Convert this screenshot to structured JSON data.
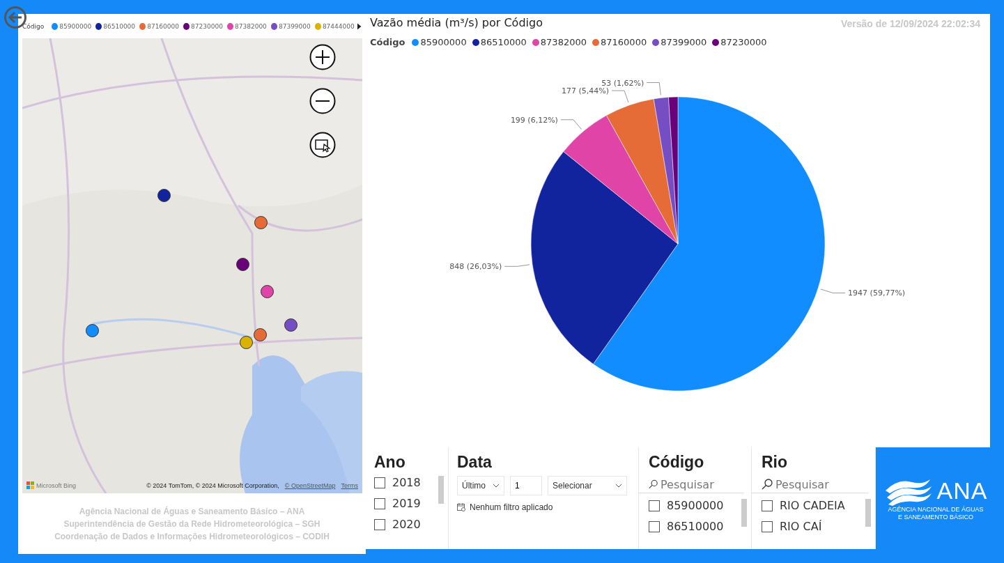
{
  "map_panel": {
    "legend": {
      "title": "Código",
      "items": [
        {
          "label": "85900000",
          "color": "#118dff"
        },
        {
          "label": "86510000",
          "color": "#12239e"
        },
        {
          "label": "87160000",
          "color": "#e66c37"
        },
        {
          "label": "87230000",
          "color": "#6b007b"
        },
        {
          "label": "87382000",
          "color": "#e044a7"
        },
        {
          "label": "87399000",
          "color": "#744ec2"
        },
        {
          "label": "87444000",
          "color": "#d9b300"
        }
      ]
    },
    "map": {
      "kind": "picture",
      "markers": [
        {
          "color": "#118dff"
        },
        {
          "color": "#12239e"
        },
        {
          "color": "#e66c37"
        },
        {
          "color": "#6b007b"
        },
        {
          "color": "#e044a7"
        },
        {
          "color": "#744ec2"
        },
        {
          "color": "#d9b300"
        },
        {
          "color": "#e66c37"
        }
      ],
      "provider": "Microsoft Bing",
      "attribution": "© 2024 TomTom, © 2024 Microsoft Corporation,",
      "attribution_link": "© OpenStreetMap",
      "terms_link": "Terms"
    },
    "footer": [
      "Agência Nacional de Águas e Saneamento Básico – ANA",
      "Superintendência de Gestão da Rede Hidrometeorológica – SGH",
      "Coordenação de Dados e Informações Hidrometeorológicos – CODIH"
    ]
  },
  "chart_panel": {
    "title": "Vazão média (m³/s) por Código",
    "version": "Versão de 12/09/2024 22:02:34",
    "legend": {
      "title": "Código",
      "items": [
        {
          "color": "#118dff"
        },
        {
          "color": "#12239e"
        },
        {
          "color": "#e044a7"
        },
        {
          "color": "#e66c37"
        },
        {
          "color": "#744ec2"
        },
        {
          "color": "#6b007b"
        }
      ]
    },
    "chart_data": {
      "type": "pie",
      "categories": [
        "85900000",
        "86510000",
        "87382000",
        "87160000",
        "87399000",
        "87230000"
      ],
      "series": [
        {
          "values": [
            59.77,
            26.03,
            6.12,
            5.44,
            1.62,
            1.02
          ]
        }
      ],
      "value_labels": [
        "1947 (59,77%)",
        "848 (26,03%)",
        "199 (6,12%)",
        "177 (5,44%)",
        "53 (1,62%)",
        null
      ]
    }
  },
  "slicers": {
    "ano": {
      "title": "Ano",
      "items": [
        {
          "label": "2018",
          "checked": false
        },
        {
          "label": "2019",
          "checked": false
        },
        {
          "label": "2020",
          "checked": false
        }
      ]
    },
    "data": {
      "title": "Data",
      "mode": "Último",
      "count": "1",
      "unit": "Selecionar",
      "status": "Nenhum filtro aplicado"
    },
    "codigo": {
      "title": "Código",
      "placeholder": "Pesquisar",
      "items": [
        {
          "label": "85900000",
          "checked": false
        },
        {
          "label": "86510000",
          "checked": false
        }
      ]
    },
    "rio": {
      "title": "Rio",
      "placeholder": "Pesquisar",
      "items": [
        {
          "label": "RIO CADEIA",
          "checked": false
        },
        {
          "label": "RIO CAÍ",
          "checked": false
        }
      ]
    }
  },
  "logo": {
    "name": "ANA",
    "subtitle_lines": [
      "AGÊNCIA NACIONAL DE ÁGUAS",
      "E SANEAMENTO BÁSICO"
    ]
  }
}
